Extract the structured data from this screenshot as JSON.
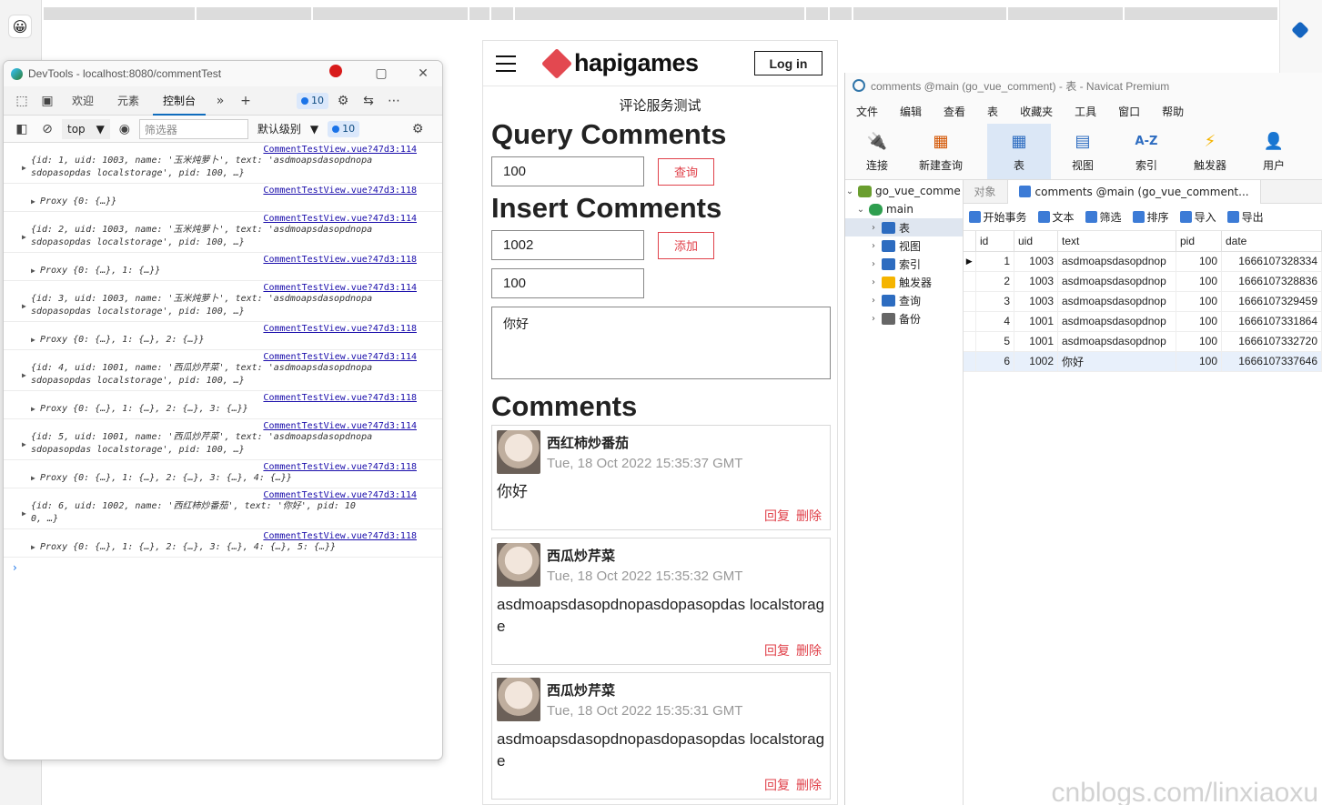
{
  "devtools": {
    "title": "DevTools - localhost:8080/commentTest",
    "tabs": [
      "欢迎",
      "元素",
      "控制台"
    ],
    "issue_count": "10",
    "context": "top",
    "filter_placeholder": "筛选器",
    "level": "默认级别",
    "logs": [
      {
        "src": "CommentTestView.vue?47d3:114",
        "line1": "{id: 1, uid: 1003, name: '玉米炖萝卜', text: 'asdmoapsdasopdnopa",
        "line2": "sdopasopdas localstorage', pid: 100, …}"
      },
      {
        "src": "CommentTestView.vue?47d3:118",
        "proxy": "Proxy {0: {…}}"
      },
      {
        "src": "CommentTestView.vue?47d3:114",
        "line1": "{id: 2, uid: 1003, name: '玉米炖萝卜', text: 'asdmoapsdasopdnopa",
        "line2": "sdopasopdas localstorage', pid: 100, …}"
      },
      {
        "src": "CommentTestView.vue?47d3:118",
        "proxy": "Proxy {0: {…}, 1: {…}}"
      },
      {
        "src": "CommentTestView.vue?47d3:114",
        "line1": "{id: 3, uid: 1003, name: '玉米炖萝卜', text: 'asdmoapsdasopdnopa",
        "line2": "sdopasopdas localstorage', pid: 100, …}"
      },
      {
        "src": "CommentTestView.vue?47d3:118",
        "proxy": "Proxy {0: {…}, 1: {…}, 2: {…}}"
      },
      {
        "src": "CommentTestView.vue?47d3:114",
        "line1": "{id: 4, uid: 1001, name: '西瓜炒芹菜', text: 'asdmoapsdasopdnopa",
        "line2": "sdopasopdas localstorage', pid: 100, …}"
      },
      {
        "src": "CommentTestView.vue?47d3:118",
        "proxy": "Proxy {0: {…}, 1: {…}, 2: {…}, 3: {…}}"
      },
      {
        "src": "CommentTestView.vue?47d3:114",
        "line1": "{id: 5, uid: 1001, name: '西瓜炒芹菜', text: 'asdmoapsdasopdnopa",
        "line2": "sdopasopdas localstorage', pid: 100, …}"
      },
      {
        "src": "CommentTestView.vue?47d3:118",
        "proxy": "Proxy {0: {…}, 1: {…}, 2: {…}, 3: {…}, 4: {…}}"
      },
      {
        "src": "CommentTestView.vue?47d3:114",
        "line1": "{id: 6, uid: 1002, name: '西红柿炒番茄', text: '你好', pid: 10",
        "line2": "0, …}"
      },
      {
        "src": "CommentTestView.vue?47d3:118",
        "proxy": "Proxy {0: {…}, 1: {…}, 2: {…}, 3: {…}, 4: {…}, 5: {…}}"
      }
    ]
  },
  "page": {
    "brand": "hapigames",
    "login": "Log in",
    "subtitle": "评论服务测试",
    "query_heading": "Query Comments",
    "query_value": "100",
    "query_button": "查询",
    "insert_heading": "Insert Comments",
    "uid_value": "1002",
    "add_button": "添加",
    "pid_value": "100",
    "text_value": "你好",
    "comments_heading": "Comments",
    "comments": [
      {
        "name": "西红柿炒番茄",
        "date": "Tue, 18 Oct 2022 15:35:37 GMT",
        "text": "你好",
        "reply": "回复",
        "delete": "删除"
      },
      {
        "name": "西瓜炒芹菜",
        "date": "Tue, 18 Oct 2022 15:35:32 GMT",
        "text": "asdmoapsdasopdnopasdopasopdas localstorage",
        "reply": "回复",
        "delete": "删除"
      },
      {
        "name": "西瓜炒芹菜",
        "date": "Tue, 18 Oct 2022 15:35:31 GMT",
        "text": "asdmoapsdasopdnopasdopasopdas localstorage",
        "reply": "回复",
        "delete": "删除"
      }
    ]
  },
  "navicat": {
    "title": "comments @main (go_vue_comment) - 表 - Navicat Premium",
    "menu": [
      "文件",
      "编辑",
      "查看",
      "表",
      "收藏夹",
      "工具",
      "窗口",
      "帮助"
    ],
    "toolbar": [
      "连接",
      "新建查询",
      "表",
      "视图",
      "索引",
      "触发器",
      "用户"
    ],
    "tree": {
      "db": "go_vue_comme",
      "schema": "main",
      "items": [
        "表",
        "视图",
        "索引",
        "触发器",
        "查询",
        "备份"
      ]
    },
    "tabs": {
      "objects": "对象",
      "active": "comments @main (go_vue_comment..."
    },
    "actions": [
      "开始事务",
      "文本",
      "筛选",
      "排序",
      "导入",
      "导出"
    ],
    "columns": [
      "id",
      "uid",
      "text",
      "pid",
      "date"
    ],
    "rows": [
      [
        "1",
        "1003",
        "asdmoapsdasopdnop",
        "100",
        "1666107328334"
      ],
      [
        "2",
        "1003",
        "asdmoapsdasopdnop",
        "100",
        "1666107328836"
      ],
      [
        "3",
        "1003",
        "asdmoapsdasopdnop",
        "100",
        "1666107329459"
      ],
      [
        "4",
        "1001",
        "asdmoapsdasopdnop",
        "100",
        "1666107331864"
      ],
      [
        "5",
        "1001",
        "asdmoapsdasopdnop",
        "100",
        "1666107332720"
      ],
      [
        "6",
        "1002",
        "你好",
        "100",
        "1666107337646"
      ]
    ]
  },
  "watermark": "cnblogs.com/linxiaoxu"
}
